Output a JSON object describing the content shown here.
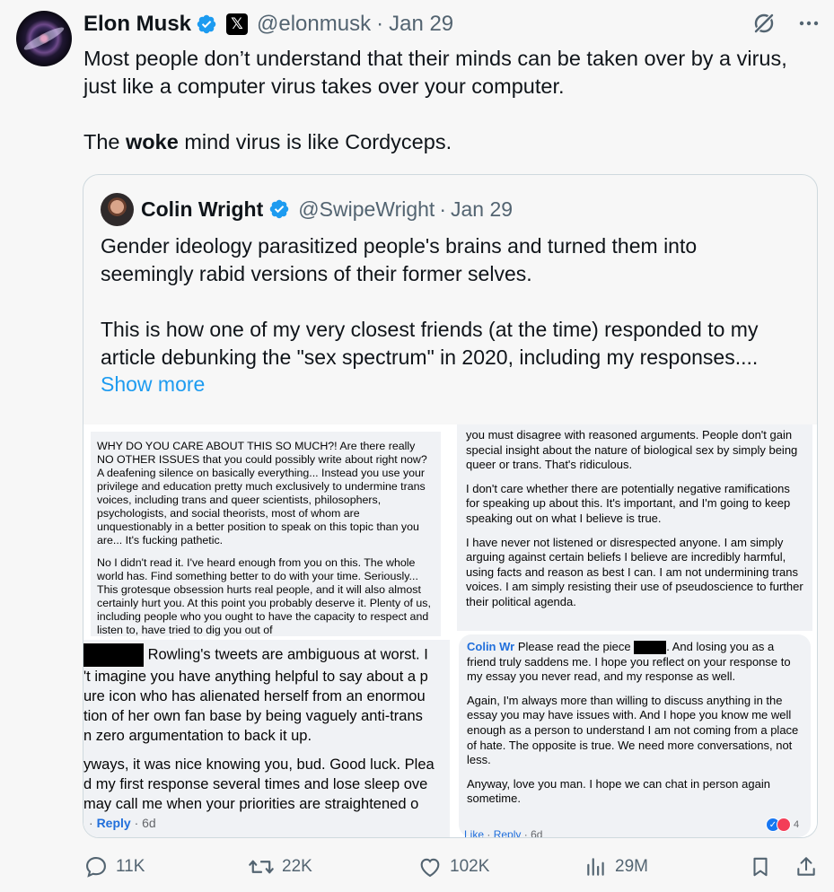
{
  "post": {
    "author_name": "Elon Musk",
    "author_handle": "@elonmusk",
    "separator": "·",
    "date": "Jan 29",
    "x_badge": "𝕏",
    "line1": "Most people don’t understand that their minds can be taken over by a virus,",
    "line2": "just like a computer virus takes over your computer.",
    "line3_pre": "The ",
    "line3_bold": "woke",
    "line3_post": " mind virus is like Cordyceps.",
    "icons": [
      "verified-badge-icon",
      "x-logo-icon",
      "grok-icon",
      "more-icon"
    ]
  },
  "quote": {
    "author_name": "Colin Wright",
    "author_handle": "@SwipeWright",
    "separator": "·",
    "date": "Jan 29",
    "line1": "Gender ideology parasitized people's brains and turned them into",
    "line2": "seemingly rabid versions of their former selves.",
    "line3": "This is how one of my very closest friends (at the time) responded to my",
    "line4": "article debunking the \"sex spectrum\" in 2020, including my responses....",
    "show_more": "Show more"
  },
  "image": {
    "panel1_para1": "WHY DO YOU CARE ABOUT THIS SO MUCH?! Are there really NO OTHER ISSUES that you could possibly write about right now? A deafening silence on basically everything... Instead you use your privilege and education pretty much exclusively to undermine trans voices, including trans and queer scientists, philosophers, psychologists, and social theorists, most of whom are unquestionably in a better position to speak on this topic than you are... It's fucking pathetic.",
    "panel1_para2": "No I didn't read it. I've heard enough from you on this. The whole world has. Find something better to do with your time. Seriously... This grotesque obsession hurts real people, and it will also almost certainly hurt you. At this point you probably deserve it. Plenty of us, including people who you ought to have the capacity to respect and listen to, have tried to dig you out of",
    "panel2_para1": "you must disagree with reasoned arguments. People don't gain special insight about the nature of biological sex by simply being queer or trans. That's ridiculous.",
    "panel2_para2": "I don't care whether there are potentially negative ramifications for speaking up about this. It's important, and I'm going to keep speaking out on what I believe is true.",
    "panel2_para3": "I have never not listened or disrespected anyone. I am simply arguing against certain beliefs I believe are incredibly harmful, using facts and reason as best I can. I am not undermining trans voices. I am simply resisting their use of pseudoscience to further their political agenda.",
    "panel3_line1": "Rowling's tweets are ambiguous at worst. I",
    "panel3_line2": "'t imagine you have anything helpful to say about a p",
    "panel3_line3": "ure icon who has alienated herself from an enormou",
    "panel3_line4": "tion of her own fan base by being vaguely anti-trans",
    "panel3_line5": "n zero argumentation to back it up.",
    "panel3_line6": "yways, it was nice knowing you, bud. Good luck. Plea",
    "panel3_line7": "d my first response several times and lose sleep ove",
    "panel3_line8": "may call me when your priorities are straightened o",
    "panel3_reply": "Reply",
    "panel3_time": "6d",
    "panel3_dot": "·",
    "panel4_author": "Colin Wr",
    "panel4_para1a": "Please read the piece",
    "panel4_para1b": ". And losing you as a friend truly saddens me. I hope you reflect on your response to my essay you never read, and my response as well.",
    "panel4_para2": "Again, I'm always more than willing to discuss anything in the essay you may have issues with. And I hope you know me well enough as a person to understand I am not coming from a place of hate. The opposite is true. We need more conversations, not less.",
    "panel4_para3": "Anyway, love you man. I hope we can chat in person again sometime.",
    "panel4_like": "Like",
    "panel4_reply": "Reply",
    "panel4_time": "6d",
    "panel4_dot": "·",
    "reaction_count": "4"
  },
  "actions": {
    "replies": "11K",
    "reposts": "22K",
    "likes": "102K",
    "views": "29M"
  },
  "colors": {
    "accent": "#1d9bf0",
    "secondary_text": "#536471",
    "fb_link": "#216fdb"
  }
}
